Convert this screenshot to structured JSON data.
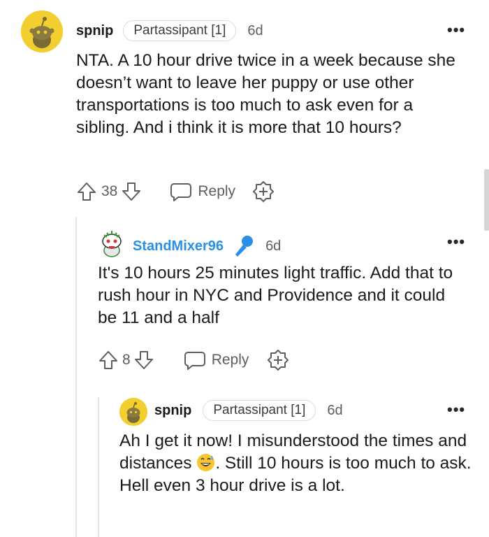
{
  "comments": [
    {
      "username": "spnip",
      "flair": "Partassipant [1]",
      "time": "6d",
      "more": "•••",
      "text": "NTA. A 10 hour drive twice in a week because she doesn’t want to leave her puppy or use other transportations is too much to ask even for a sibling. And i think it is more that 10 hours?",
      "votes": "38",
      "reply_label": "Reply"
    },
    {
      "username": "StandMixer96",
      "time": "6d",
      "more": "•••",
      "text": "It's 10 hours 25 minutes light traffic. Add that to rush hour in NYC and Providence and it could be 11 and a half",
      "votes": "8",
      "reply_label": "Reply"
    },
    {
      "username": "spnip",
      "flair": "Partassipant [1]",
      "time": "6d",
      "more": "•••",
      "text_before_emoji": "Ah I get it now! I misunderstood the times and distances ",
      "text_after_emoji": ". Still 10 hours is too much to ask. Hell even 3 hour drive is a lot."
    }
  ],
  "colors": {
    "username_blue": "#2c8fe6",
    "avatar_yellow": "#f2cf2e",
    "muted_text": "#5e5e5e"
  },
  "icons": [
    "snoo-avatar",
    "microphone-icon",
    "upvote-icon",
    "downvote-icon",
    "chat-bubble-icon",
    "award-plus-icon",
    "grin-sweat-emoji"
  ]
}
